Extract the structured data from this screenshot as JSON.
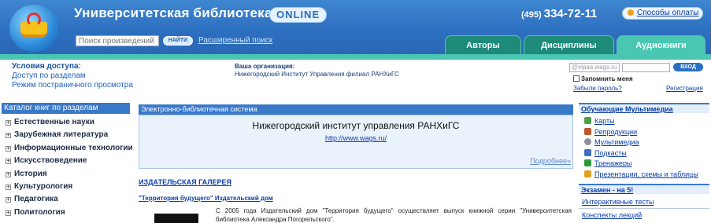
{
  "header": {
    "title": "Университетская библиотека",
    "badge": "ONLINE",
    "phone_code": "(495)",
    "phone_number": "334-72-11",
    "payment_link": "Способы оплаты",
    "search_placeholder": "Поиск произведений",
    "search_button": "НАЙТИ",
    "advanced_search": "Расширенный поиск",
    "tabs": [
      {
        "label": "Авторы",
        "active": false
      },
      {
        "label": "Дисциплины",
        "active": false
      },
      {
        "label": "Аудиокниги",
        "active": true
      }
    ]
  },
  "access": {
    "heading": "Условия доступа:",
    "links": [
      "Доступ по разделам",
      "Режим постраничного просмотра"
    ]
  },
  "organization": {
    "heading": "Ваша организация:",
    "name": "Нижегородский Институт Управления филиал РАНХиГС"
  },
  "login": {
    "login_value": "@vipaa.wags.ru",
    "enter_button": "ВХОД",
    "remember_label": "Запомнить меня",
    "forgot_link": "Забыли пароль?",
    "register_link": "Регистрация"
  },
  "catalog": {
    "heading": "Каталог книг по разделам",
    "items": [
      "Естественные науки",
      "Зарубежная литература",
      "Информационные технологии",
      "Искусствоведение",
      "История",
      "Культурология",
      "Педагогика",
      "Политология"
    ]
  },
  "ebs": {
    "heading": "Электронно-библиотечная система",
    "org_name": "Нижегородский институт управления РАНХиГС",
    "org_url": "http://www.wags.ru/",
    "more": "Подробнее»"
  },
  "gallery": {
    "heading": "ИЗДАТЕЛЬСКАЯ ГАЛЕРЕЯ",
    "subheading": "\"Территория будущего\" Издательский дом",
    "text": "С 2005 года Издательский дом \"Территория будущего\" осуществляет выпуск книжной серии \"Университетская библиотека Александра Погорельского\"."
  },
  "multimedia": {
    "heading": "Обучающие Мультимедиа",
    "items": [
      {
        "label": "Карты",
        "icon": "map-icon",
        "color": "#4aa04a"
      },
      {
        "label": "Репродукции",
        "icon": "picture-icon",
        "color": "#c0562a"
      },
      {
        "label": "Мультимедиа",
        "icon": "multimedia-icon",
        "color": "#8a8f9a"
      },
      {
        "label": "Подкасты",
        "icon": "podcast-icon",
        "color": "#3a6fc0"
      },
      {
        "label": "Тренажеры",
        "icon": "trainer-icon",
        "color": "#2e9a3e"
      },
      {
        "label": "Презентации, схемы и таблицы",
        "icon": "presentation-icon",
        "color": "#e0a020"
      }
    ]
  },
  "exam": {
    "heading": "Экзамен - на 5!",
    "items": [
      "Интерактивные тесты",
      "Конспекты лекций"
    ]
  }
}
